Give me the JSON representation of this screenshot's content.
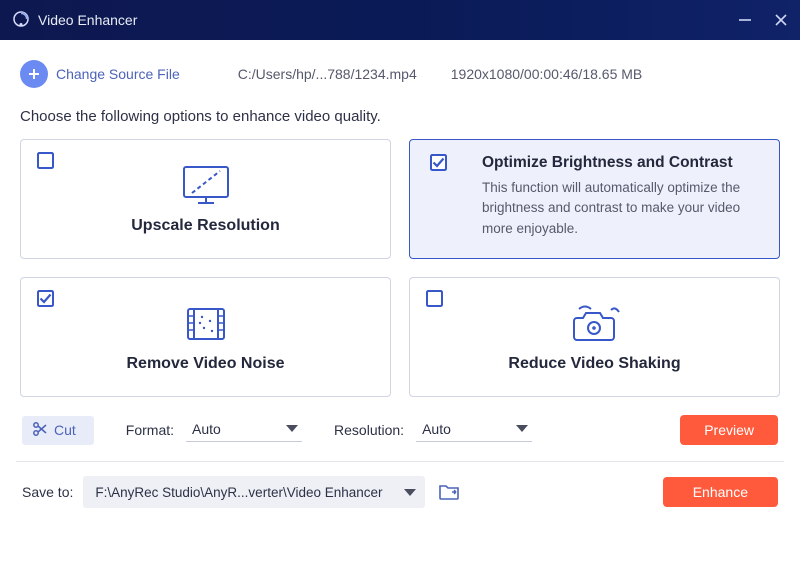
{
  "titlebar": {
    "title": "Video Enhancer"
  },
  "source": {
    "change_label": "Change Source File",
    "filepath": "C:/Users/hp/...788/1234.mp4",
    "fileinfo": "1920x1080/00:00:46/18.65 MB"
  },
  "instruction": "Choose the following options to enhance video quality.",
  "options": {
    "upscale": {
      "title": "Upscale Resolution",
      "checked": false
    },
    "brightness": {
      "title": "Optimize Brightness and Contrast",
      "desc": "This function will automatically optimize the brightness and contrast to make your video more enjoyable.",
      "checked": true
    },
    "noise": {
      "title": "Remove Video Noise",
      "checked": true
    },
    "shaking": {
      "title": "Reduce Video Shaking",
      "checked": false
    }
  },
  "controls": {
    "cut": "Cut",
    "format_label": "Format:",
    "format_value": "Auto",
    "res_label": "Resolution:",
    "res_value": "Auto",
    "preview": "Preview"
  },
  "footer": {
    "saveto_label": "Save to:",
    "path": "F:\\AnyRec Studio\\AnyR...verter\\Video Enhancer",
    "enhance": "Enhance"
  }
}
